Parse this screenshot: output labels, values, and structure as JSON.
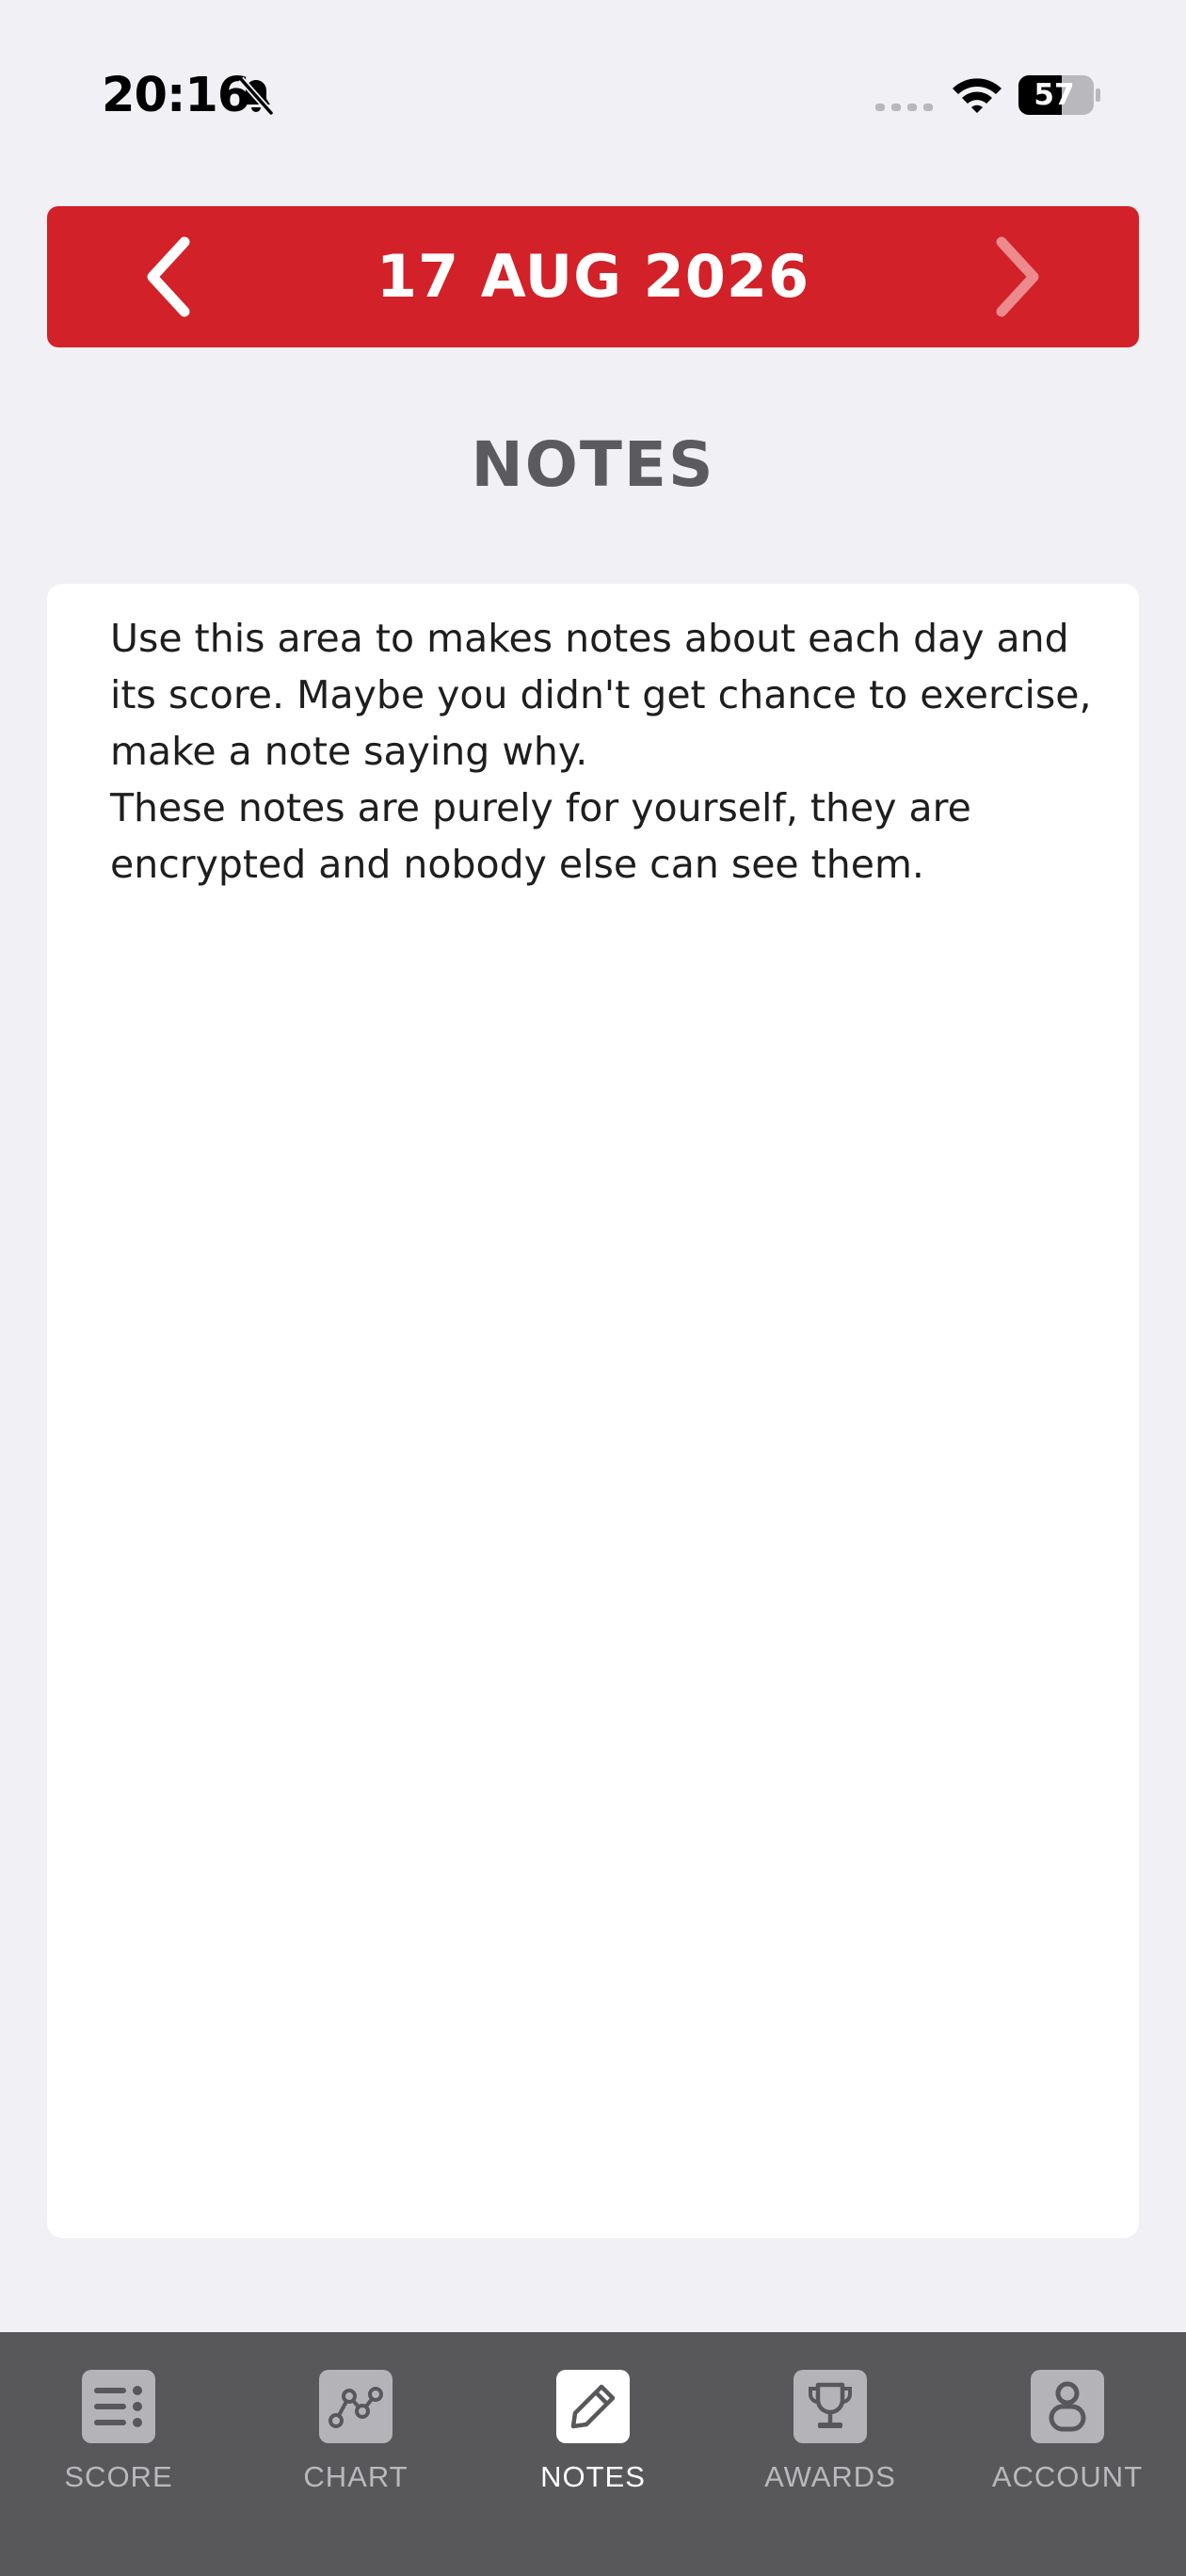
{
  "status_bar": {
    "time": "20:16",
    "battery_level": "57"
  },
  "date_nav": {
    "date": "17 AUG 2026"
  },
  "page": {
    "title": "NOTES"
  },
  "notes": {
    "text": "Use this area to makes notes about each day and its score. Maybe you didn't get chance to exercise, make a note saying why.\nThese notes are purely for yourself, they are encrypted and nobody else can see them."
  },
  "tabs": [
    {
      "label": "SCORE",
      "icon": "list-icon",
      "active": false
    },
    {
      "label": "CHART",
      "icon": "chart-icon",
      "active": false
    },
    {
      "label": "NOTES",
      "icon": "pencil-icon",
      "active": true
    },
    {
      "label": "AWARDS",
      "icon": "trophy-icon",
      "active": false
    },
    {
      "label": "ACCOUNT",
      "icon": "account-icon",
      "active": false
    }
  ],
  "colors": {
    "accent": "#d22128",
    "background": "#f1f0f5",
    "tab_bar": "#58585b",
    "title": "#5b5b5f"
  }
}
